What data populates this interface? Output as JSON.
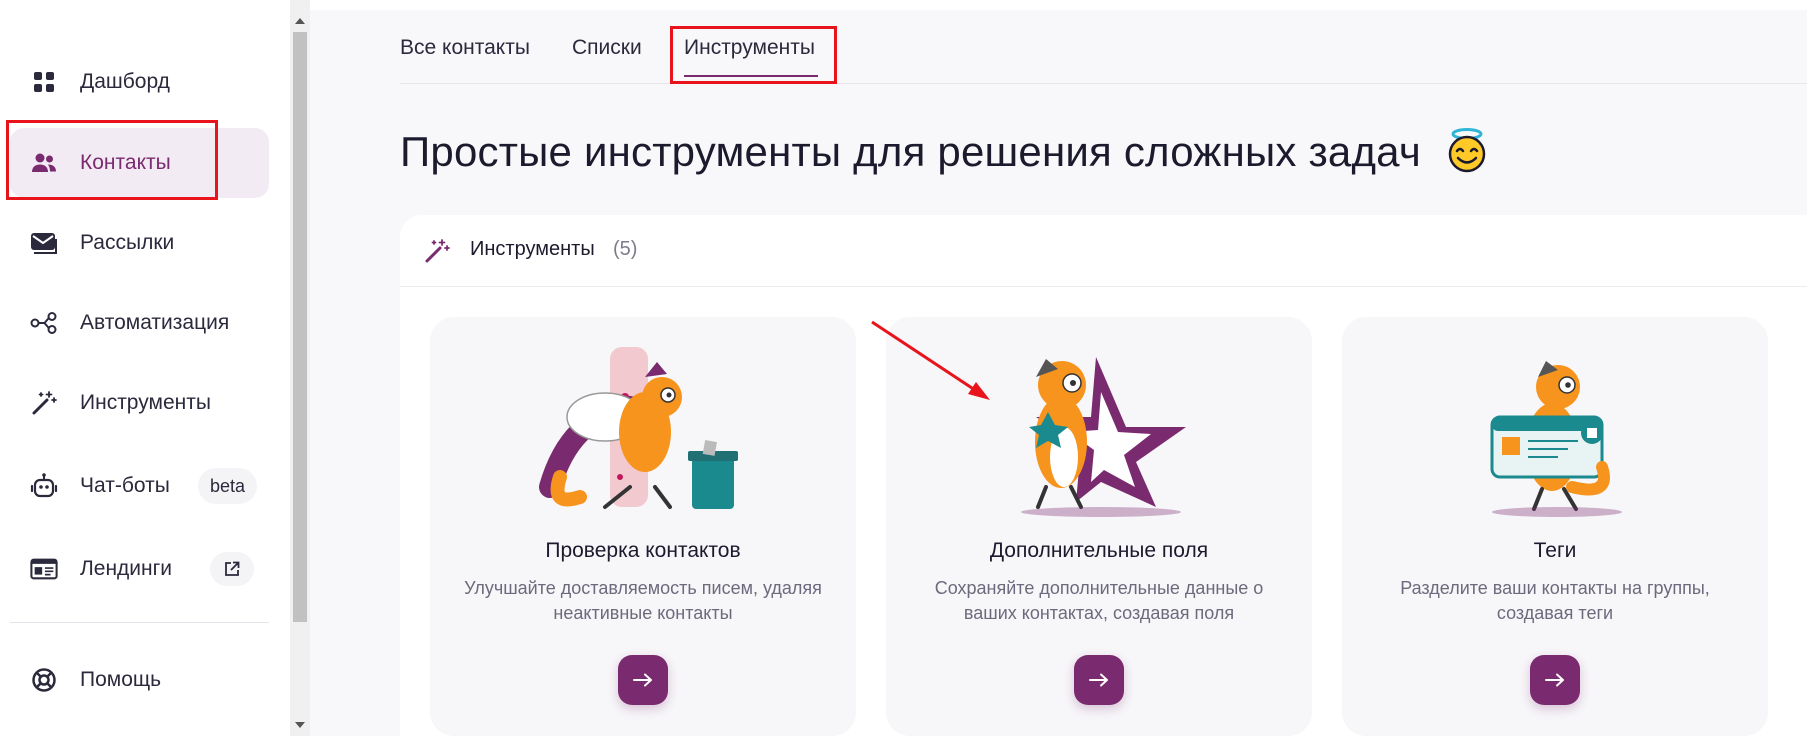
{
  "sidebar": {
    "items": [
      {
        "label": "Дашборд",
        "icon": "dashboard-icon"
      },
      {
        "label": "Контакты",
        "icon": "contacts-icon",
        "active": true
      },
      {
        "label": "Рассылки",
        "icon": "mail-icon"
      },
      {
        "label": "Автоматизация",
        "icon": "automation-icon"
      },
      {
        "label": "Инструменты",
        "icon": "magic-wand-icon"
      },
      {
        "label": "Чат-боты",
        "icon": "bot-icon",
        "badge": "beta"
      },
      {
        "label": "Лендинги",
        "icon": "landing-icon",
        "badge_icon": "external-link-icon"
      },
      {
        "label": "Помощь",
        "icon": "help-icon"
      }
    ]
  },
  "tabs": [
    {
      "label": "Все контакты"
    },
    {
      "label": "Списки"
    },
    {
      "label": "Инструменты",
      "active": true
    }
  ],
  "page": {
    "title": "Простые инструменты для решения сложных задач",
    "title_emoji": "smiling-face-with-halo"
  },
  "panel": {
    "title": "Инструменты",
    "count": "(5)",
    "icon": "magic-wand-icon"
  },
  "cards": [
    {
      "title": "Проверка контактов",
      "desc": "Улучшайте доставляемость писем, удаляя неактивные контакты",
      "illustration": "fox-with-broom-and-trash-bin"
    },
    {
      "title": "Дополнительные поля",
      "desc": "Сохраняйте дополнительные данные о ваших контактах, создавая поля",
      "illustration": "fox-with-star"
    },
    {
      "title": "Теги",
      "desc": "Разделите ваши контакты на группы, создавая теги",
      "illustration": "fox-with-tag-card"
    }
  ],
  "colors": {
    "accent": "#7a2a6f",
    "highlight": "#e8131b",
    "active_bg": "#f3ebf3"
  }
}
